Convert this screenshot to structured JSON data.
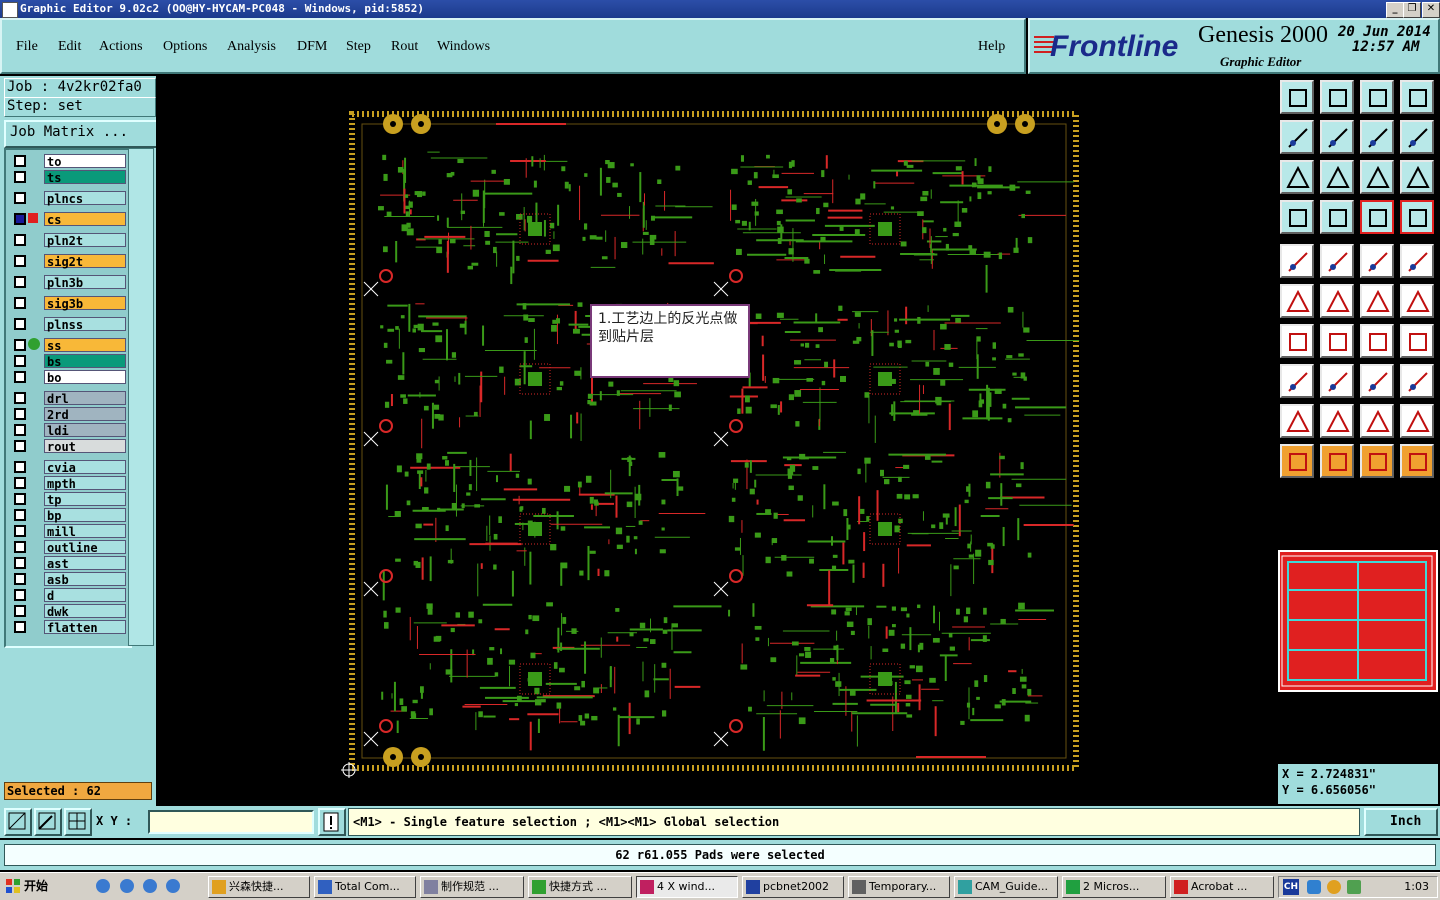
{
  "window": {
    "title": "Graphic Editor 9.02c2 (OO@HY-HYCAM-PC048 - Windows, pid:5852)",
    "controls": [
      "_",
      "❐",
      "✕"
    ]
  },
  "menu": {
    "items": [
      "File",
      "Edit",
      "Actions",
      "Options",
      "Analysis",
      "DFM",
      "Step",
      "Rout",
      "Windows"
    ],
    "help": "Help"
  },
  "brand": {
    "logo": "Frontline",
    "product": "Genesis 2000",
    "subtitle": "Graphic Editor",
    "date": "20 Jun 2014",
    "time": "12:57 AM"
  },
  "job": {
    "job_line": "Job : 4v2kr02fa0",
    "step_line": "Step: set",
    "matrix_button": "Job Matrix ..."
  },
  "layers": [
    {
      "name": "to",
      "color": "#ffffff"
    },
    {
      "name": "ts",
      "color": "#0a9a7a"
    },
    {
      "name": "plncs",
      "color": "#a8e0e0"
    },
    {
      "name": "cs",
      "color": "#f8b838"
    },
    {
      "name": "pln2t",
      "color": "#a8e0e0"
    },
    {
      "name": "sig2t",
      "color": "#f8b838"
    },
    {
      "name": "pln3b",
      "color": "#a8e0e0"
    },
    {
      "name": "sig3b",
      "color": "#f8b838"
    },
    {
      "name": "plnss",
      "color": "#a8e0e0"
    },
    {
      "name": "ss",
      "color": "#f8b838"
    },
    {
      "name": "bs",
      "color": "#0a9a7a"
    },
    {
      "name": "bo",
      "color": "#ffffff"
    },
    {
      "name": "drl",
      "color": "#a0b4c0"
    },
    {
      "name": "2rd",
      "color": "#a0b4c0"
    },
    {
      "name": "ldi",
      "color": "#a0b4c0"
    },
    {
      "name": "rout",
      "color": "#d8dcdc"
    },
    {
      "name": "cvia",
      "color": "#a8e0e0"
    },
    {
      "name": "mpth",
      "color": "#a8e0e0"
    },
    {
      "name": "tp",
      "color": "#a8e0e0"
    },
    {
      "name": "bp",
      "color": "#a8e0e0"
    },
    {
      "name": "mill",
      "color": "#a8e0e0"
    },
    {
      "name": "outline",
      "color": "#a8e0e0"
    },
    {
      "name": "ast",
      "color": "#a8e0e0"
    },
    {
      "name": "asb",
      "color": "#a8e0e0"
    },
    {
      "name": "d",
      "color": "#a8e0e0"
    },
    {
      "name": "dwk",
      "color": "#a8e0e0"
    },
    {
      "name": "flatten",
      "color": "#a8e0e0"
    }
  ],
  "selected": "Selected : 62",
  "note": "1.工艺边上的反光点做到贴片层",
  "coords": {
    "x": "X = 2.724831\"",
    "y": "Y = 6.656056\""
  },
  "cmd": {
    "xy_label": "X Y :",
    "xy_value": "",
    "hint": "<M1> - Single feature selection ; <M1><M1> Global selection",
    "units": "Inch"
  },
  "status_message": "62 r61.055 Pads were selected",
  "taskbar": {
    "start": "开始",
    "tasks": [
      "兴森快捷...",
      "Total Com...",
      "制作规范 ...",
      "快捷方式 ...",
      "4 X wind...",
      "pcbnet2002",
      "Temporary...",
      "CAM_Guide...",
      "2 Micros...",
      "Acrobat ..."
    ],
    "ime": "CH",
    "clock": "1:03"
  },
  "colors": {
    "panel": "#a0dcdc",
    "trace_green": "#3a9a18",
    "trace_red": "#d82828",
    "pad_gold": "#c8a020"
  }
}
